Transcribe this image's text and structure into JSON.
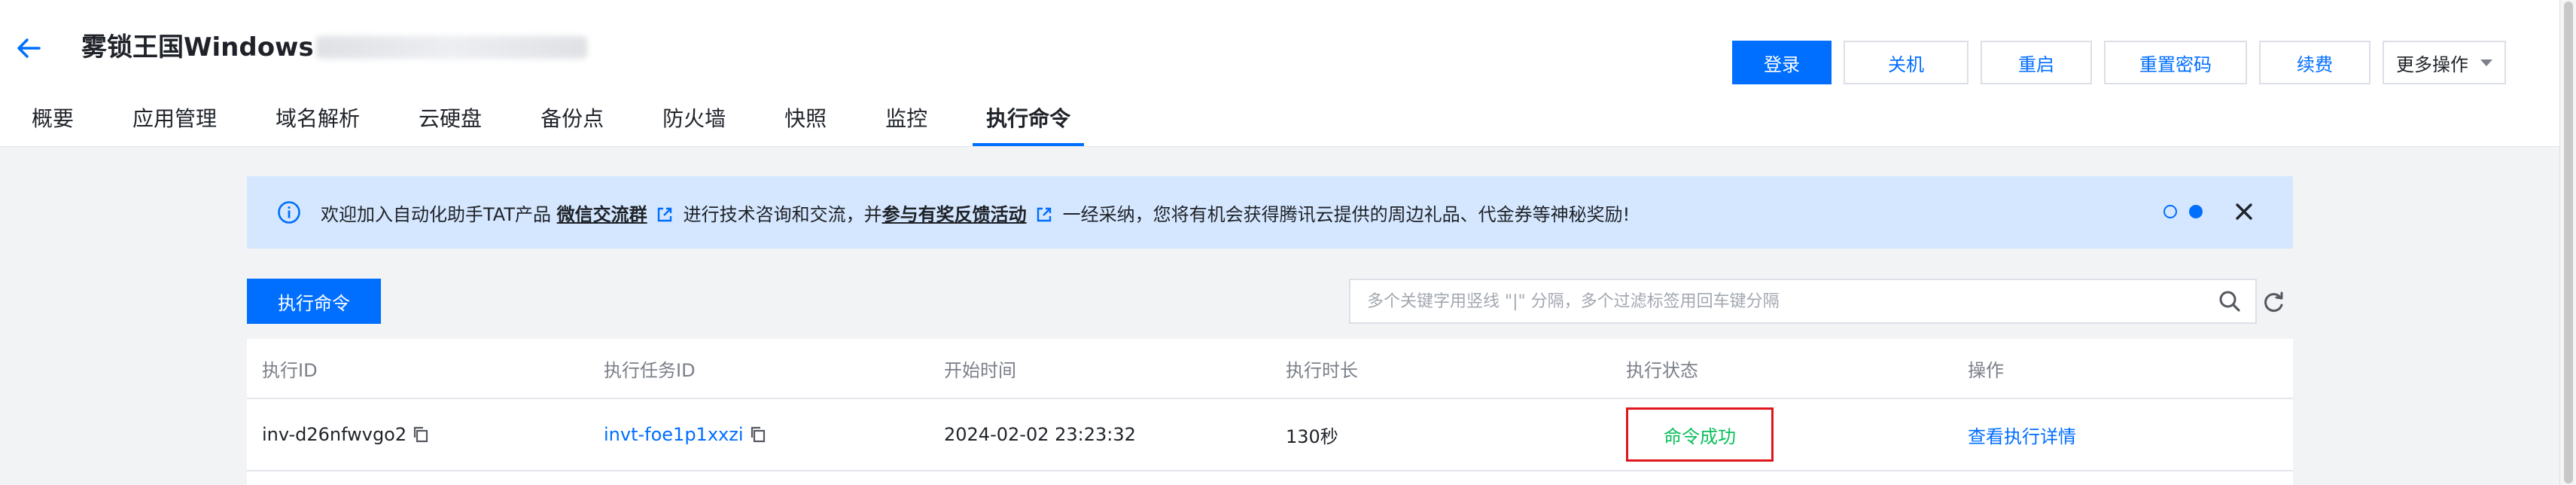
{
  "header": {
    "title": "雾锁王国Windows",
    "buttons": {
      "login": "登录",
      "shutdown": "关机",
      "restart": "重启",
      "reset_password": "重置密码",
      "renew": "续费",
      "more": "更多操作"
    }
  },
  "tabs": [
    {
      "label": "概要",
      "active": false
    },
    {
      "label": "应用管理",
      "active": false
    },
    {
      "label": "域名解析",
      "active": false
    },
    {
      "label": "云硬盘",
      "active": false
    },
    {
      "label": "备份点",
      "active": false
    },
    {
      "label": "防火墙",
      "active": false
    },
    {
      "label": "快照",
      "active": false
    },
    {
      "label": "监控",
      "active": false
    },
    {
      "label": "执行命令",
      "active": true
    }
  ],
  "banner": {
    "text_1": "欢迎加入自动化助手TAT产品",
    "link_1": "微信交流群",
    "text_2": "进行技术咨询和交流，并",
    "link_2": "参与有奖反馈活动",
    "text_3": "一经采纳，您将有机会获得腾讯云提供的周边礼品、代金券等神秘奖励!",
    "dots": [
      false,
      true
    ]
  },
  "toolbar": {
    "run_button": "执行命令",
    "search_placeholder": "多个关键字用竖线 \"|\" 分隔，多个过滤标签用回车键分隔"
  },
  "table": {
    "columns": [
      "执行ID",
      "执行任务ID",
      "开始时间",
      "执行时长",
      "执行状态",
      "操作"
    ],
    "rows": [
      {
        "exec_id": "inv-d26nfwvgo2",
        "task_id": "invt-foe1p1xxzi",
        "start_time": "2024-02-02 23:23:32",
        "duration": "130秒",
        "status": "命令成功",
        "action": "查看执行详情"
      }
    ]
  },
  "colors": {
    "primary": "#006eff",
    "success": "#0abf5b",
    "highlight_border": "#e0161d",
    "banner_bg": "#d5e7ff"
  }
}
